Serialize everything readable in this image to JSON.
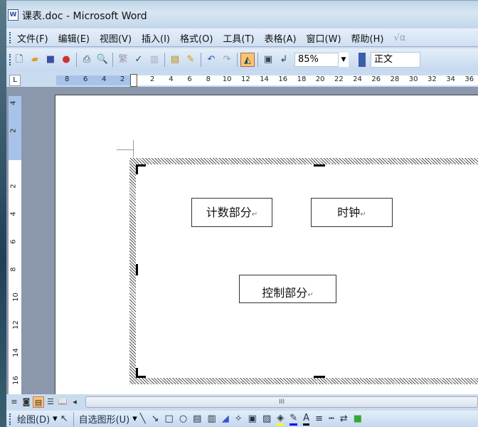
{
  "window": {
    "title": "课表.doc - Microsoft Word",
    "app_icon": "word-doc-icon"
  },
  "menu": [
    "文件(F)",
    "编辑(E)",
    "视图(V)",
    "插入(I)",
    "格式(O)",
    "工具(T)",
    "表格(A)",
    "窗口(W)",
    "帮助(H)"
  ],
  "menu_extra": "√α",
  "toolbar": {
    "zoom": "85%",
    "style": "正文",
    "extra": "繁"
  },
  "ruler": {
    "h_left": [
      "8",
      "6",
      "4",
      "2"
    ],
    "h_right": [
      "2",
      "4",
      "6",
      "8",
      "10",
      "12",
      "14",
      "16",
      "18",
      "20",
      "22",
      "24",
      "26",
      "28",
      "30",
      "32",
      "34",
      "36"
    ],
    "v": [
      "4",
      "2",
      "",
      "2",
      "4",
      "6",
      "8",
      "10",
      "12",
      "14",
      "16"
    ],
    "tab_selector": "L"
  },
  "document": {
    "boxes": [
      "计数部分",
      "时钟",
      "控制部分"
    ],
    "para_mark": "↵"
  },
  "scroll": {
    "thumb": "III"
  },
  "drawbar": {
    "draw": "绘图(D)",
    "autoshapes": "自选图形(U)"
  }
}
